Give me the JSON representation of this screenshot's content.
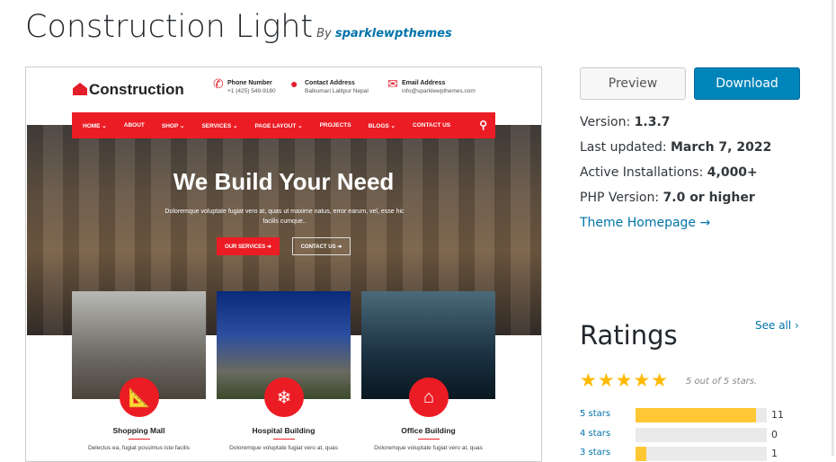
{
  "theme": {
    "name": "Construction Light",
    "by": "By",
    "author": "sparklewpthemes"
  },
  "preview": {
    "logo": "Construction",
    "contacts": [
      {
        "label": "Phone Number",
        "value": "+1 (425) 549-9180",
        "icon": "phone-icon"
      },
      {
        "label": "Contact Address",
        "value": "Balkumari Lalitpur Nepal",
        "icon": "map-pin-icon"
      },
      {
        "label": "Email Address",
        "value": "info@sparklewpthemes.com",
        "icon": "envelope-icon"
      }
    ],
    "nav": [
      "HOME ⌄",
      "ABOUT",
      "SHOP ⌄",
      "SERVICES ⌄",
      "PAGE LAYOUT ⌄",
      "PROJECTS",
      "BLOGS ⌄",
      "CONTACT US"
    ],
    "hero": {
      "title": "We Build Your Need",
      "text": "Doloremque voluptate fugiat vero at, quas ut maxime natus, error earum, vel, esse hic facilis cumque..",
      "btn1": "OUR SERVICES  ➔",
      "btn2": "CONTACT US  ➔"
    },
    "cards": [
      {
        "title": "Shopping Mall",
        "text": "Delectus ea, fugiat possimus iste facilis",
        "icon": "ruler-icon"
      },
      {
        "title": "Hospital Building",
        "text": "Doloremque voluptate fugiat vero at, quas",
        "icon": "snowflake-icon"
      },
      {
        "title": "Office Building",
        "text": "Doloremque voluptate fugiat vero at, quas",
        "icon": "home-icon"
      }
    ]
  },
  "actions": {
    "preview": "Preview",
    "download": "Download"
  },
  "meta": [
    {
      "label": "Version: ",
      "value": "1.3.7"
    },
    {
      "label": "Last updated: ",
      "value": "March 7, 2022"
    },
    {
      "label": "Active Installations: ",
      "value": "4,000+"
    },
    {
      "label": "PHP Version: ",
      "value": "7.0 or higher"
    }
  ],
  "homepage": "Theme Homepage →",
  "ratings": {
    "title": "Ratings",
    "see_all": "See all ›",
    "stars_text": "5 out of 5 stars.",
    "stars": 5,
    "rows": [
      {
        "label": "5 stars",
        "count": "11",
        "fraction": 0.917
      },
      {
        "label": "4 stars",
        "count": "0",
        "fraction": 0
      },
      {
        "label": "3 stars",
        "count": "1",
        "fraction": 0.083
      }
    ]
  },
  "colors": {
    "brand_red": "#ec1c24",
    "wp_blue": "#0085ba",
    "star": "#ffb900"
  }
}
